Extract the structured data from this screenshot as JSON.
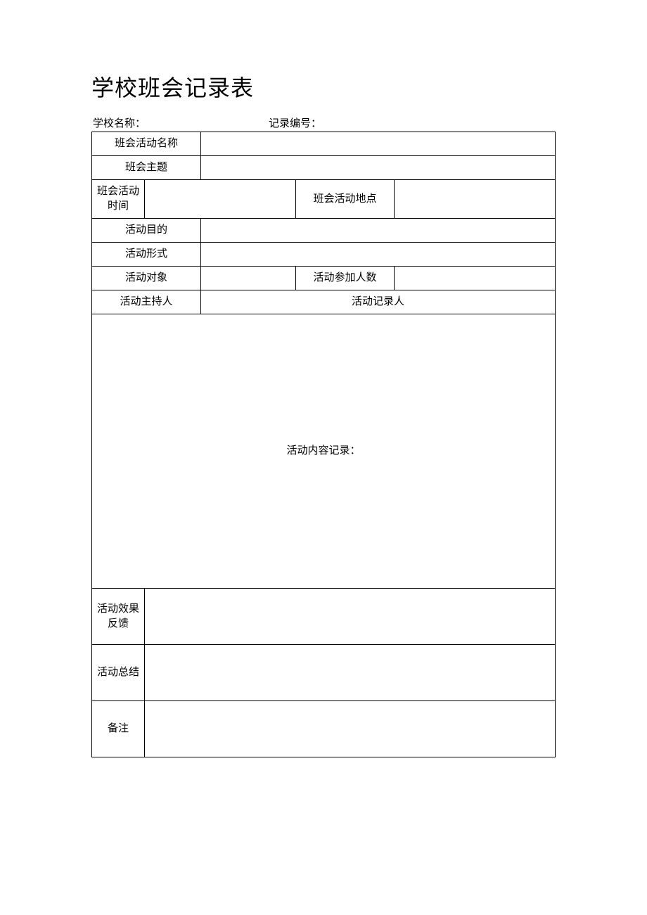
{
  "title": "学校班会记录表",
  "meta": {
    "school_label": "学校名称：",
    "record_label": "记录编号："
  },
  "rows": {
    "activity_name": "班会活动名称",
    "theme": "班会主题",
    "time": "班会活动时间",
    "location": "班会活动地点",
    "purpose": "活动目的",
    "form": "活动形式",
    "target": "活动对象",
    "participants": "活动参加人数",
    "host": "活动主持人",
    "recorder": "活动记录人",
    "content": "活动内容记录：",
    "feedback": "活动效果反馈",
    "summary": "活动总结",
    "remark": "备注"
  }
}
